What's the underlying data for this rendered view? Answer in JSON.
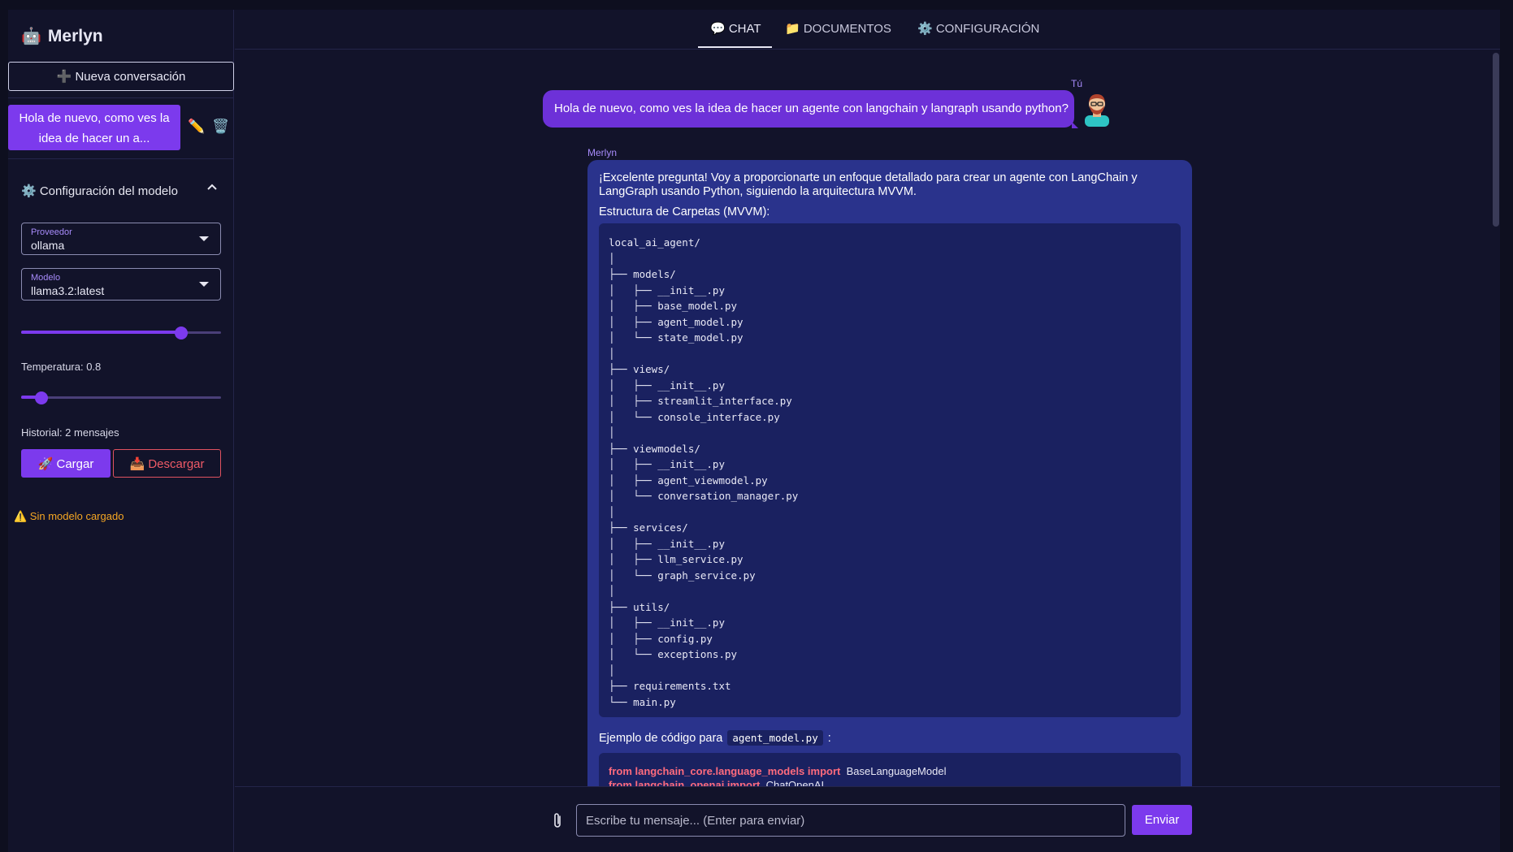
{
  "app": {
    "name": "Merlyn",
    "logo_icon": "🤖"
  },
  "sidebar": {
    "new_conversation": "➕ Nueva conversación",
    "conversations": [
      {
        "title": "Hola de nuevo, como ves la idea de hacer un a..."
      }
    ],
    "edit_icon": "✏️",
    "delete_icon": "🗑️",
    "model_config": {
      "title": "⚙️ Configuración del modelo",
      "chevron": "⌃",
      "provider_label": "Proveedor",
      "provider_value": "ollama",
      "model_label": "Modelo",
      "model_value": "llama3.2:latest",
      "slider1_fraction": 0.8,
      "temperature_label": "Temperatura: 0.8",
      "temperature_fraction": 0.1,
      "history_label": "Historial: 2 mensajes"
    },
    "load_button": "🚀 Cargar",
    "unload_button": "📥 Descargar",
    "warning": "⚠️ Sin modelo cargado"
  },
  "tabs": [
    {
      "label": "💬 CHAT",
      "active": true
    },
    {
      "label": "📁 DOCUMENTOS",
      "active": false
    },
    {
      "label": "⚙️ CONFIGURACIÓN",
      "active": false
    }
  ],
  "chat": {
    "user_label": "Tú",
    "user_message": "Hola de nuevo, como ves la idea de hacer un agente con langchain y langraph usando python?",
    "bot_label": "Merlyn",
    "bot_intro": "¡Excelente pregunta! Voy a proporcionarte un enfoque detallado para crear un agente con LangChain y LangGraph usando Python, siguiendo la arquitectura MVVM.",
    "bot_structure_title": "Estructura de Carpetas (MVVM):",
    "folder_tree": "local_ai_agent/\n│\n├── models/\n│   ├── __init__.py\n│   ├── base_model.py\n│   ├── agent_model.py\n│   └── state_model.py\n│\n├── views/\n│   ├── __init__.py\n│   ├── streamlit_interface.py\n│   └── console_interface.py\n│\n├── viewmodels/\n│   ├── __init__.py\n│   ├── agent_viewmodel.py\n│   └── conversation_manager.py\n│\n├── services/\n│   ├── __init__.py\n│   ├── llm_service.py\n│   └── graph_service.py\n│\n├── utils/\n│   ├── __init__.py\n│   ├── config.py\n│   └── exceptions.py\n│\n├── requirements.txt\n└── main.py",
    "example_label": "Ejemplo de código para",
    "example_file": "agent_model.py",
    "example_colon": ":",
    "code_lines": [
      {
        "kw": "from langchain_core.language_models import",
        "id": "BaseLanguageModel"
      },
      {
        "kw": "from langchain_openai import",
        "id": "ChatOpenAI"
      }
    ]
  },
  "composer": {
    "attach_icon": "📎",
    "placeholder": "Escribe tu mensaje... (Enter para enviar)",
    "value": "",
    "send_label": "Enviar"
  },
  "colors": {
    "accent": "#7c3aed",
    "background": "#12132a",
    "bot_bubble": "#2a338c",
    "danger": "#ef5a66",
    "warning": "#f5a623"
  }
}
